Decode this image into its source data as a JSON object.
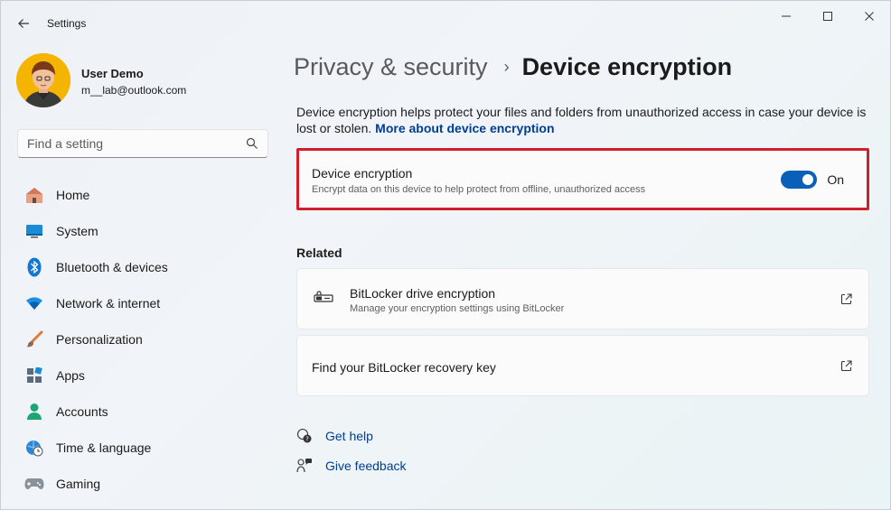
{
  "window": {
    "title": "Settings",
    "controls": [
      "minimize-icon",
      "maximize-icon",
      "close-icon"
    ]
  },
  "profile": {
    "name": "User Demo",
    "email": "m__lab@outlook.com"
  },
  "search": {
    "placeholder": "Find a setting"
  },
  "sidebar": {
    "items": [
      {
        "label": "Home",
        "icon": "home-icon"
      },
      {
        "label": "System",
        "icon": "system-icon"
      },
      {
        "label": "Bluetooth & devices",
        "icon": "bluetooth-icon"
      },
      {
        "label": "Network & internet",
        "icon": "wifi-icon"
      },
      {
        "label": "Personalization",
        "icon": "brush-icon"
      },
      {
        "label": "Apps",
        "icon": "apps-icon"
      },
      {
        "label": "Accounts",
        "icon": "account-icon"
      },
      {
        "label": "Time & language",
        "icon": "clock-globe-icon"
      },
      {
        "label": "Gaming",
        "icon": "gamepad-icon"
      }
    ]
  },
  "breadcrumb": {
    "parent": "Privacy & security",
    "separator": "›",
    "current": "Device encryption"
  },
  "description": {
    "text": "Device encryption helps protect your files and folders from unauthorized access in case your device is lost or stolen.",
    "link": "More about device encryption"
  },
  "encryption_card": {
    "title": "Device encryption",
    "subtitle": "Encrypt data on this device to help protect from offline, unauthorized access",
    "toggle_state": "On",
    "highlight_color": "#d01f2b"
  },
  "related": {
    "heading": "Related",
    "items": [
      {
        "title": "BitLocker drive encryption",
        "subtitle": "Manage your encryption settings using BitLocker",
        "icon": "bitlocker-key-icon"
      },
      {
        "title": "Find your BitLocker recovery key"
      }
    ]
  },
  "help": {
    "get_help": "Get help",
    "give_feedback": "Give feedback"
  },
  "colors": {
    "accent": "#0a5fb8",
    "link": "#003e92"
  }
}
